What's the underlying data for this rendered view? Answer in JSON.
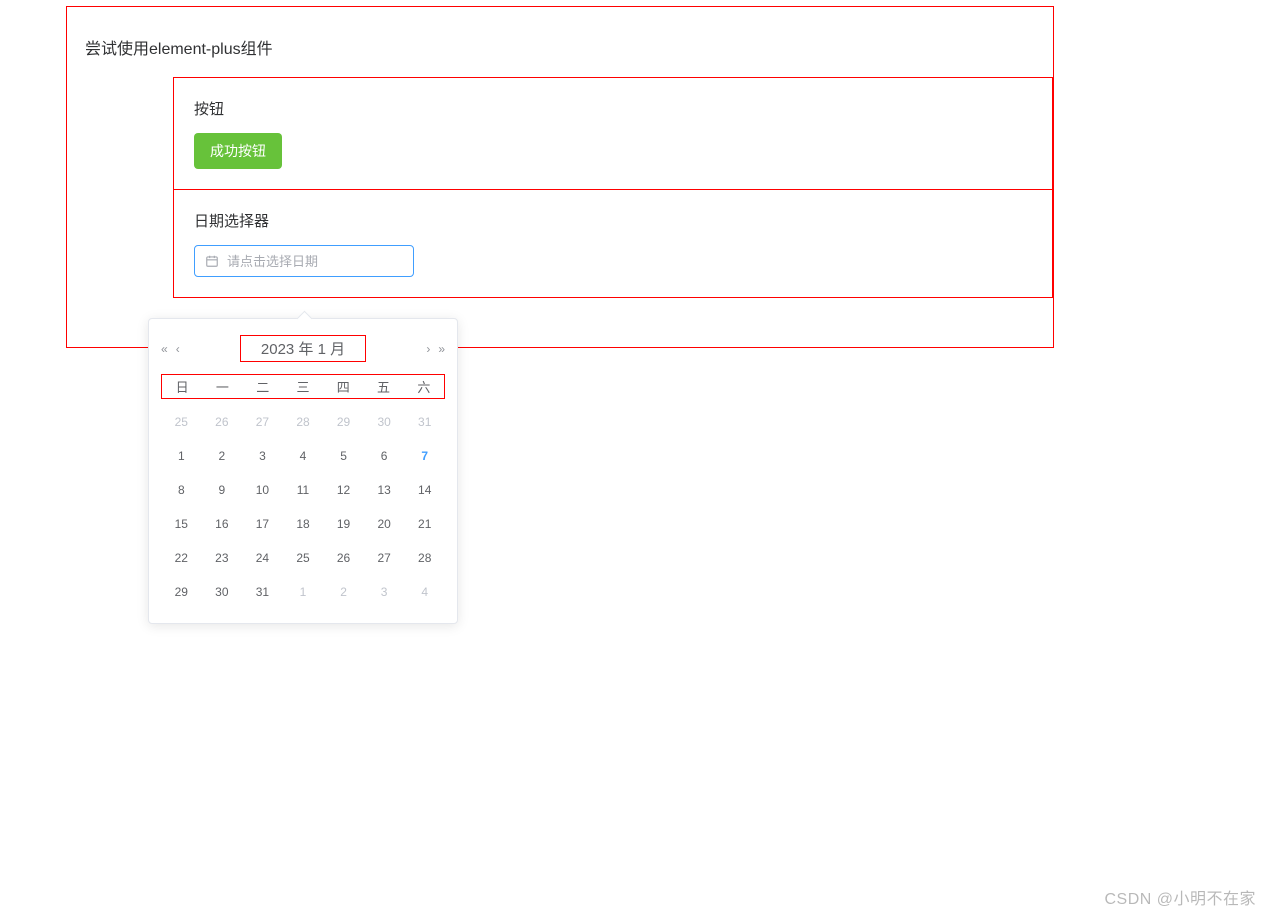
{
  "page": {
    "title": "尝试使用element-plus组件"
  },
  "sections": {
    "button": {
      "heading": "按钮",
      "success_label": "成功按钮"
    },
    "datepicker": {
      "heading": "日期选择器",
      "placeholder": "请点击选择日期"
    }
  },
  "calendar": {
    "header_label": "2023 年  1 月",
    "weekdays": [
      "日",
      "一",
      "二",
      "三",
      "四",
      "五",
      "六"
    ],
    "days": [
      {
        "n": 25,
        "other": true
      },
      {
        "n": 26,
        "other": true
      },
      {
        "n": 27,
        "other": true
      },
      {
        "n": 28,
        "other": true
      },
      {
        "n": 29,
        "other": true
      },
      {
        "n": 30,
        "other": true
      },
      {
        "n": 31,
        "other": true
      },
      {
        "n": 1
      },
      {
        "n": 2
      },
      {
        "n": 3
      },
      {
        "n": 4
      },
      {
        "n": 5
      },
      {
        "n": 6
      },
      {
        "n": 7,
        "today": true
      },
      {
        "n": 8
      },
      {
        "n": 9
      },
      {
        "n": 10
      },
      {
        "n": 11
      },
      {
        "n": 12
      },
      {
        "n": 13
      },
      {
        "n": 14
      },
      {
        "n": 15
      },
      {
        "n": 16
      },
      {
        "n": 17
      },
      {
        "n": 18
      },
      {
        "n": 19
      },
      {
        "n": 20
      },
      {
        "n": 21
      },
      {
        "n": 22
      },
      {
        "n": 23
      },
      {
        "n": 24
      },
      {
        "n": 25
      },
      {
        "n": 26
      },
      {
        "n": 27
      },
      {
        "n": 28
      },
      {
        "n": 29
      },
      {
        "n": 30
      },
      {
        "n": 31
      },
      {
        "n": 1,
        "other": true
      },
      {
        "n": 2,
        "other": true
      },
      {
        "n": 3,
        "other": true
      },
      {
        "n": 4,
        "other": true
      }
    ],
    "nav": {
      "prev_year": "«",
      "prev_month": "‹",
      "next_month": "›",
      "next_year": "»"
    }
  },
  "watermark": "CSDN @小明不在家"
}
